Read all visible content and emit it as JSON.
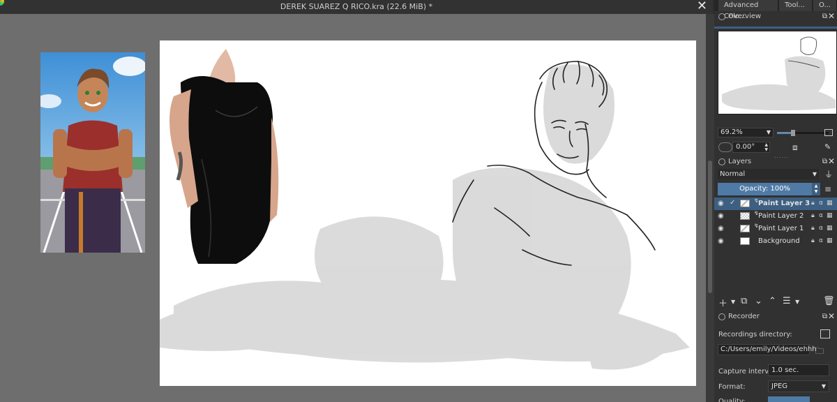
{
  "window": {
    "title": "DEREK SUAREZ Q RICO.kra (22.6 MiB) *",
    "close_symbol": "✕"
  },
  "dock_tabs": [
    "Advanced Colo...",
    "Tool...",
    "O..."
  ],
  "overview": {
    "title": "Overview",
    "zoom": "69.2%",
    "rotation": "0.00°"
  },
  "layers_panel": {
    "title": "Layers",
    "blend_mode": "Normal",
    "opacity_label": "Opacity:  100%",
    "layers": [
      {
        "name": "Paint Layer 3",
        "selected": true
      },
      {
        "name": "Paint Layer 2",
        "selected": false
      },
      {
        "name": "Paint Layer 1",
        "selected": false
      },
      {
        "name": "Background",
        "selected": false
      }
    ]
  },
  "recorder": {
    "title": "Recorder",
    "directory_label": "Recordings directory:",
    "directory_path": "C:/Users/emily/Videos/ehhh",
    "capture_label": "Capture interval:",
    "capture_value": "1.0 sec.",
    "format_label": "Format:",
    "format_value": "JPEG",
    "quality_label": "Quality:"
  },
  "colors": {
    "accent": "#4f7aa5",
    "selection": "#3d5f82",
    "canvas_bg": "#6e6e6e",
    "panel_bg": "#313131"
  }
}
